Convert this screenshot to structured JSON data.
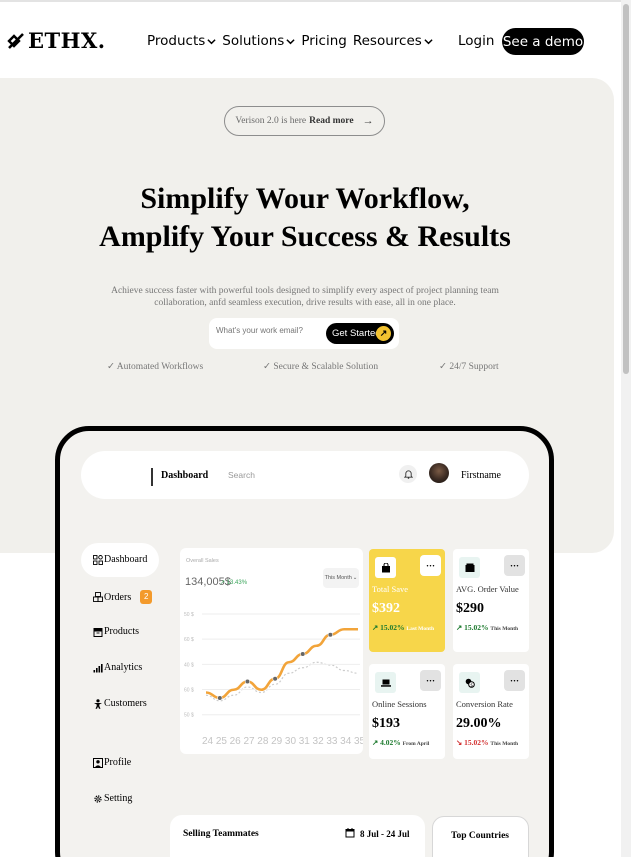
{
  "header": {
    "logo_text": "ETHX.",
    "nav": [
      {
        "label": "Products",
        "dropdown": true
      },
      {
        "label": "Solutions",
        "dropdown": true
      },
      {
        "label": "Pricing",
        "dropdown": false
      },
      {
        "label": "Resources",
        "dropdown": true
      }
    ],
    "login_label": "Login",
    "demo_label": "See a demo"
  },
  "hero": {
    "pill_prefix": "Verison 2.0 is here",
    "pill_link": "Read more",
    "headline_line1": "Simplify Wour Workflow,",
    "headline_line2": "Amplify Your Success & Results",
    "subtext": "Achieve success faster with powerful tools designed to simplify every aspect of project planning team collaboration, anfd seamless execution, drive results with ease, all in one place.",
    "email_placeholder": "What's your work email?",
    "cta_label": "Get Started",
    "features": [
      "✓ Automated Workflows",
      "✓ Secure & Scalable Solution",
      "✓ 24/7 Support"
    ]
  },
  "dashboard": {
    "title": "Dashboard",
    "search_placeholder": "Search",
    "username": "Firstname",
    "sidebar": [
      {
        "label": "Dashboard",
        "icon": "grid-icon"
      },
      {
        "label": "Orders",
        "icon": "boxes-icon",
        "badge": "2"
      },
      {
        "label": "Products",
        "icon": "archive-icon"
      },
      {
        "label": "Analytics",
        "icon": "bar-chart-icon"
      },
      {
        "label": "Customers",
        "icon": "person-icon"
      },
      {
        "label": "Profile",
        "icon": "profile-icon"
      },
      {
        "label": "Setting",
        "icon": "gear-icon"
      }
    ],
    "sales_card": {
      "label": "Overall Sales",
      "value": "134,005$",
      "change": "↗ 13.43%",
      "period": "This Month"
    },
    "stats": [
      {
        "title": "Total Save",
        "value": "$392",
        "delta": "15.02%",
        "note": "Last Month",
        "direction": "up",
        "icon": "bag-icon",
        "accent": "#f7d64a"
      },
      {
        "title": "AVG. Order Value",
        "value": "$290",
        "delta": "15.02%",
        "note": "This Month",
        "direction": "up",
        "icon": "wallet-icon"
      },
      {
        "title": "Online Sessions",
        "value": "$193",
        "delta": "4.02%",
        "note": "From April",
        "direction": "up",
        "icon": "laptop-icon"
      },
      {
        "title": "Conversion Rate",
        "value": "29.00%",
        "delta": "15.02%",
        "note": "This Month",
        "direction": "down",
        "icon": "coins-icon"
      }
    ],
    "selling": {
      "title": "Selling Teammates",
      "dates": "8 Jul - 24 Jul"
    },
    "top_countries": "Top Countries"
  },
  "chart_data": {
    "type": "line",
    "x": [
      24,
      25,
      26,
      27,
      28,
      29,
      30,
      31,
      32,
      33,
      34,
      35
    ],
    "y_ticks": [
      "50 $",
      "60 $",
      "40 $",
      "60 $",
      "50 $"
    ],
    "series": [
      {
        "values": [
          35,
          33,
          36,
          39,
          36,
          40,
          46,
          49,
          52,
          56,
          58,
          58
        ],
        "color": "#f2a43a"
      },
      {
        "values": [
          34,
          32,
          34,
          37,
          35,
          38,
          42,
          44,
          46,
          45,
          43,
          42
        ],
        "color": "#cccccc"
      }
    ],
    "ylim": [
      25,
      65
    ]
  }
}
